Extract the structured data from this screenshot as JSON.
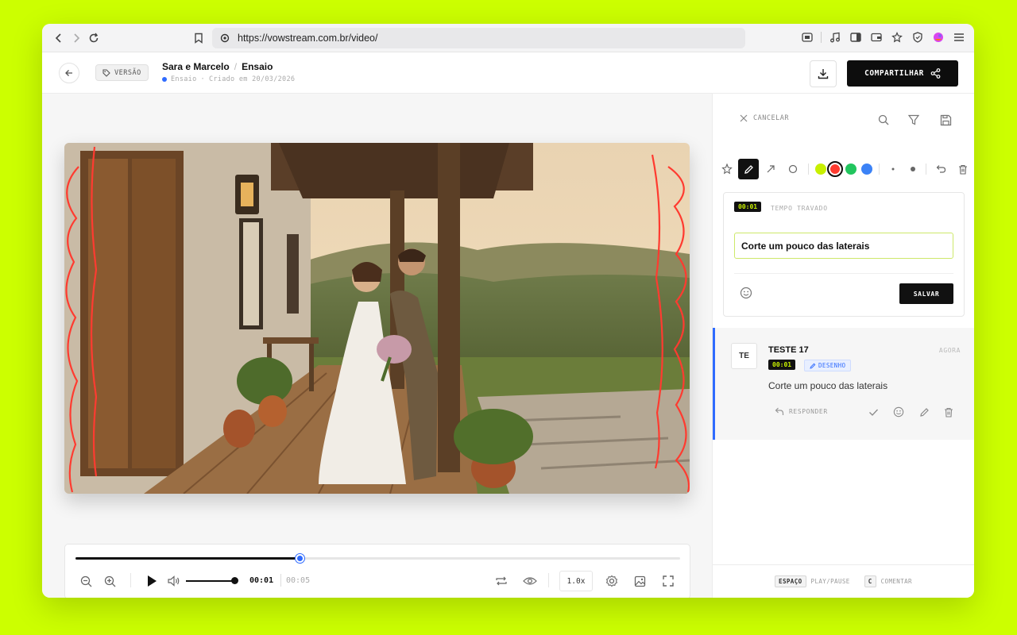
{
  "browser": {
    "url": "https://vowstream.com.br/video/"
  },
  "header": {
    "version_label": "VERSÃO",
    "project": "Sara e Marcelo",
    "page": "Ensaio",
    "status": "Ensaio",
    "created": "Criado em 20/03/2026",
    "share_label": "COMPARTILHAR"
  },
  "player": {
    "current_time": "00:01",
    "total_time": "00:05",
    "progress": 0.37,
    "volume": 1.0,
    "speed": "1.0x"
  },
  "panel": {
    "cancel_label": "CANCELAR",
    "colors": {
      "lime": "#c8f000",
      "red": "#ff3b30",
      "green": "#22c55e",
      "blue": "#3b82f6"
    },
    "selected_color": "red",
    "composer": {
      "time": "00:01",
      "lock_label": "TEMPO TRAVADO",
      "text": "Corte um pouco das laterais",
      "save_label": "SALVAR"
    },
    "comment": {
      "avatar": "TE",
      "author": "TESTE 17",
      "time_ago": "AGORA",
      "time": "00:01",
      "tag": "DESENHO",
      "text": "Corte um pouco das laterais",
      "reply_label": "RESPONDER"
    },
    "shortcuts": {
      "key1": "ESPAÇO",
      "label1": "PLAY/PAUSE",
      "key2": "C",
      "label2": "COMENTAR"
    }
  },
  "accent": "#2f6bff",
  "background": "#ccff00"
}
